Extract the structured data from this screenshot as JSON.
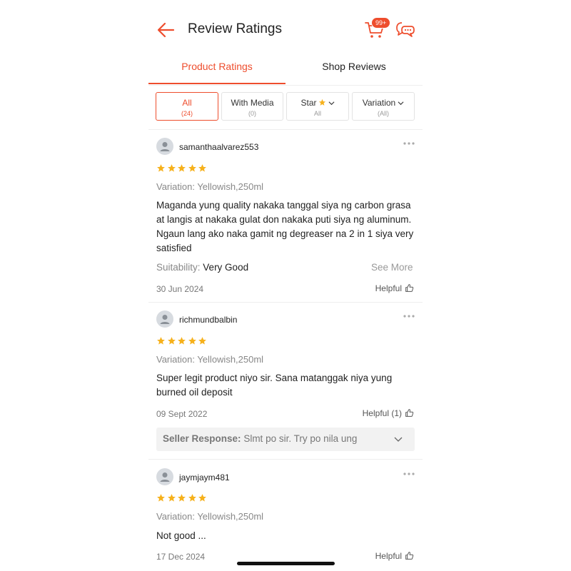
{
  "header": {
    "title": "Review Ratings",
    "cart_badge": "99+",
    "accent": "#ee4d2d"
  },
  "tabs": [
    {
      "label": "Product Ratings",
      "active": true
    },
    {
      "label": "Shop Reviews",
      "active": false
    }
  ],
  "filters": [
    {
      "label": "All",
      "sub": "(24)",
      "active": true
    },
    {
      "label": "With Media",
      "sub": "(0)",
      "active": false
    },
    {
      "label": "Star",
      "sub": "All",
      "active": false,
      "icon": "star-icon"
    },
    {
      "label": "Variation",
      "sub": "(All)",
      "active": false
    }
  ],
  "reviews": [
    {
      "username": "samanthaalvarez553",
      "rating": 5,
      "variation": "Variation: Yellowish,250ml",
      "body": "Maganda yung quality nakaka tanggal siya ng carbon grasa at langis at nakaka gulat don nakaka puti siya ng aluminum. Ngaun lang ako naka gamit ng degreaser na 2 in 1 siya very satisfied",
      "suitability_label": "Suitability:",
      "suitability_value": "Very Good",
      "see_more": "See More",
      "date": "30 Jun 2024",
      "helpful": "Helpful"
    },
    {
      "username": "richmundbalbin",
      "rating": 5,
      "variation": "Variation: Yellowish,250ml",
      "body": "Super legit product niyo sir. Sana matanggak niya yung burned oil deposit",
      "date": "09 Sept 2022",
      "helpful": "Helpful (1)",
      "seller_label": "Seller Response:",
      "seller_text": "Slmt po sir. Try po nila ung"
    },
    {
      "username": "jaymjaym481",
      "rating": 5,
      "variation": "Variation: Yellowish,250ml",
      "body": "Not good ...",
      "date": "17 Dec 2024",
      "helpful": "Helpful"
    }
  ]
}
